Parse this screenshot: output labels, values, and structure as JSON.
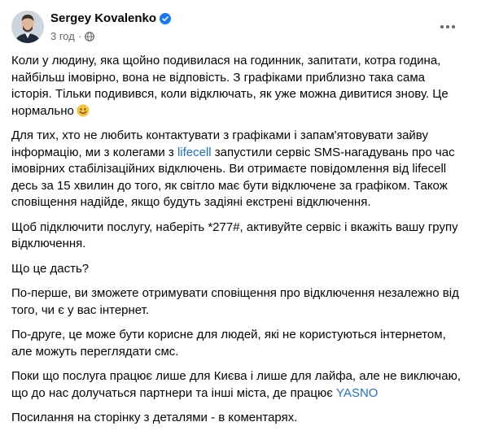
{
  "post": {
    "author": "Sergey Kovalenko",
    "time": "3 год",
    "separator": "·",
    "icons": {
      "verified": "verified-badge-icon",
      "privacy": "globe-icon",
      "menu": "more-options-icon",
      "emoji": "smiling-face-emoji"
    },
    "colors": {
      "link": "#216fdb",
      "verified": "#1877f2",
      "meta": "#65676b"
    },
    "paragraphs": {
      "p1": "Коли у людину, яка щойно подивилася на годинник, запитати, котра година, найбільш імовірно, вона не відповість. З графіками приблизно така сама історія. Тільки подивився, коли відключать, як уже можна дивитися знову. Це нормально",
      "p2_before": "Для тих, хто не любить контактувати з графіками і запам'ятовувати зайву інформацію, ми з колегами з ",
      "p2_link": "lifecell",
      "p2_after": " запустили сервіс SMS-нагадувань про час імовірних стабілізаційних відключень. Ви отримаєте повідомлення від lifecell десь за 15 хвилин до того, як світло має бути відключене за графіком. Також сповіщення надійде, якщо будуть задіяні екстрені відключення.",
      "p3": "Щоб підключити послугу, наберіть *277#, активуйте сервіс і вкажіть вашу групу відключення.",
      "p4": "Що це дасть?",
      "p5": "По-перше, ви зможете отримувати сповіщення про відключення незалежно від того, чи є у вас інтернет.",
      "p6": "По-друге, це може бути корисне для людей, які не користуються інтернетом, але можуть переглядати смс.",
      "p7_before": "Поки що послуга працює лише для Києва і лише для лайфа, але не виключаю, що до нас долучаться партнери  та інші міста, де працює ",
      "p7_link": "YASNO",
      "p8": "Посилання на сторінку з деталями - в коментарях."
    }
  }
}
